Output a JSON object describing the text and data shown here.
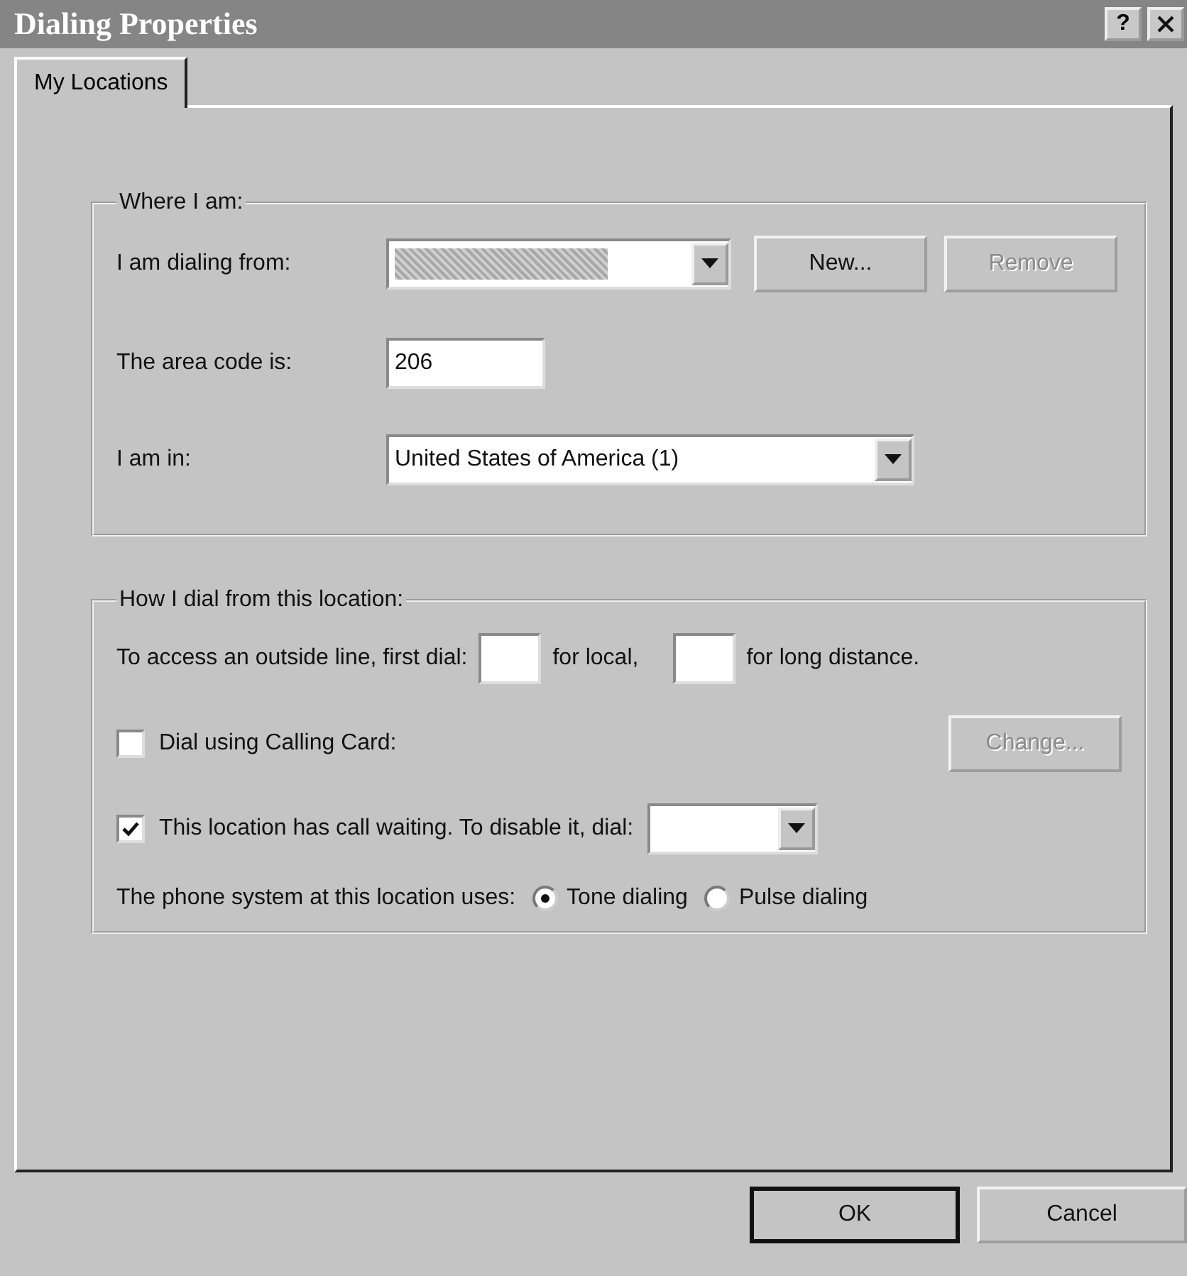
{
  "window": {
    "title": "Dialing Properties",
    "help_button": "?"
  },
  "tabs": [
    {
      "label": "My Locations",
      "selected": true
    }
  ],
  "where_group": {
    "title": "Where I am:",
    "dialing_from": {
      "label": "I am dialing from:"
    },
    "new_button": {
      "label": "New...",
      "disabled": false
    },
    "remove_button": {
      "label": "Remove",
      "disabled": true
    },
    "area_code": {
      "label": "The area code is:",
      "value": "206"
    },
    "country": {
      "label": "I am in:",
      "value": "United States of America (1)"
    }
  },
  "how_group": {
    "title": "How I dial from this location:",
    "outside_line": {
      "label": "To access an outside line, first dial:",
      "local_label": "for local,",
      "long_label": "for long distance."
    },
    "calling_card": {
      "label": "Dial using Calling Card:",
      "checked": false
    },
    "change_button": {
      "label": "Change...",
      "disabled": true
    },
    "call_waiting": {
      "label": "This location has call waiting. To disable it, dial:",
      "checked": true
    },
    "phone_system": {
      "label": "The phone system at this location uses:",
      "options": [
        {
          "label": "Tone dialing",
          "selected": true
        },
        {
          "label": "Pulse dialing",
          "selected": false
        }
      ]
    }
  },
  "buttons": [
    {
      "label": "OK",
      "default": true
    },
    {
      "label": "Cancel",
      "default": false
    }
  ]
}
